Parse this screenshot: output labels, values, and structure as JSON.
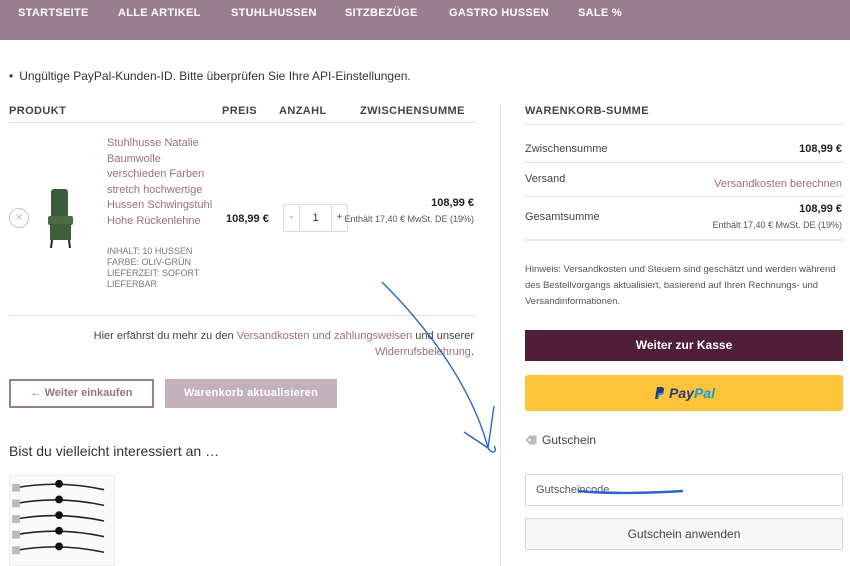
{
  "nav": {
    "items": [
      "STARTSEITE",
      "ALLE ARTIKEL",
      "STUHLHUSSEN",
      "SITZBEZÜGE",
      "GASTRO HUSSEN",
      "SALE %"
    ]
  },
  "notice": {
    "text": "Ungültige PayPal-Kunden-ID. Bitte überprüfen Sie Ihre API-Einstellungen."
  },
  "cart": {
    "headers": {
      "product": "PRODUKT",
      "price": "PREIS",
      "quantity": "ANZAHL",
      "subtotal": "ZWISCHENSUMME"
    },
    "item": {
      "remove": "×",
      "name": "Stuhlhusse Natalie Baumwolle verschieden Farben stretch hochwertige Hussen Schwingstuhl Hohe Rückenlehne",
      "meta": [
        "INHALT: 10 HUSSEN",
        "FARBE: OLIV-GRÜN",
        "LIEFERZEIT: SOFORT LIEFERBAR"
      ],
      "price": "108,99 €",
      "qty_minus": "-",
      "qty_value": "1",
      "qty_plus": "+",
      "subtotal": "108,99 €",
      "subtotal_tax": "Enthält 17,40 € MwSt. DE (19%)"
    },
    "shipping_info": {
      "before": "Hier erfährst du mehr zu den ",
      "link1": "Versandkosten und zahlungsweisen",
      "middle": " und unserer ",
      "link2": "Widerrufsbelehrung",
      "after": "."
    },
    "continue_button": "← Weiter einkaufen",
    "update_button": "Warenkorb aktualisieren",
    "cross_sell_title": "Bist du vielleicht interessiert an …"
  },
  "totals": {
    "heading": "WARENKORB-SUMME",
    "subtotal_label": "Zwischensumme",
    "subtotal_value": "108,99 €",
    "shipping_label": "Versand",
    "shipping_value": "Versandkosten berechnen",
    "total_label": "Gesamtsumme",
    "total_value": "108,99 €",
    "total_tax": "Enthält 17,40 € MwSt. DE (19%)",
    "hint": "Hinweis: Versandkosten und Steuern sind geschätzt und werden während des Bestellvorgangs aktualisiert, basierend auf Ihren Rechnungs- und Versandinformationen.",
    "checkout_button": "Weiter zur Kasse",
    "paypal_pay": "Pay",
    "paypal_pal": "Pal",
    "coupon_heading": "Gutschein",
    "coupon_placeholder": "Gutscheincode",
    "coupon_button": "Gutschein anwenden"
  },
  "colors": {
    "nav_bg": "#9b7e8d",
    "link": "#9b6f86",
    "checkout_bg": "#4e1f36",
    "paypal_bg": "#ffc439",
    "annotation": "#2b66c6"
  }
}
